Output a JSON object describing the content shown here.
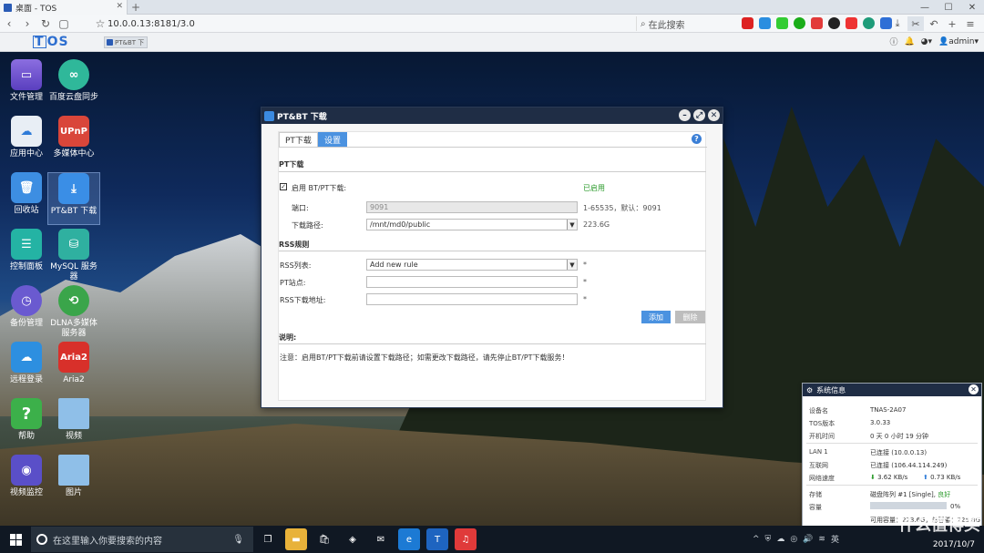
{
  "browser": {
    "tab_title": "桌面 - TOS",
    "new_tab": "+",
    "url": "10.0.0.13:8181/3.0",
    "search_placeholder": "在此搜索"
  },
  "tos_bar": {
    "logo": "OS",
    "logo_t": "T",
    "task_tab_label": "PT&BT 下",
    "user": "admin"
  },
  "desktop_icons": [
    {
      "label": "文件管理"
    },
    {
      "label": "百度云盘同步"
    },
    {
      "label": "应用中心"
    },
    {
      "label": "多媒体中心",
      "icon_text": "UPnP"
    },
    {
      "label": "回收站"
    },
    {
      "label": "PT&BT 下载"
    },
    {
      "label": "控制面板"
    },
    {
      "label": "MySQL 服务器"
    },
    {
      "label": "备份管理"
    },
    {
      "label": "DLNA多媒体服务器"
    },
    {
      "label": "远程登录"
    },
    {
      "label": "Aria2",
      "icon_text": "Aria2"
    },
    {
      "label": "帮助",
      "icon_text": "?"
    },
    {
      "label": "视频"
    },
    {
      "label": "视频监控"
    },
    {
      "label": "图片"
    }
  ],
  "pt_window": {
    "title": "PT&BT 下载",
    "tab_download": "PT下载",
    "tab_settings": "设置",
    "section_pt": "PT下载",
    "enable_label": "启用 BT/PT下载:",
    "enabled_status": "已启用",
    "port_label": "端口:",
    "port_value": "9091",
    "port_hint": "1-65535，默认：9091",
    "path_label": "下载路径:",
    "path_value": "/mnt/md0/public",
    "path_size": "223.6G",
    "section_rss": "RSS规则",
    "rss_list_label": "RSS列表:",
    "rss_list_value": "Add new rule",
    "pt_site_label": "PT站点:",
    "rss_url_label": "RSS下载地址:",
    "required_mark": "*",
    "add_button": "添加",
    "delete_button": "删除",
    "section_notes": "说明:",
    "note_text": "注意：启用BT/PT下载前请设置下载路径；如需更改下载路径，请先停止BT/PT下载服务！"
  },
  "sysinfo": {
    "title": "系统信息",
    "device_label": "设备名",
    "device_value": "TNAS-2A07",
    "tos_label": "TOS版本",
    "tos_value": "3.0.33",
    "uptime_label": "开机时间",
    "uptime_value": "0 天 0 小时 19 分钟",
    "lan_label": "LAN 1",
    "lan_value": "已连接 (10.0.0.13)",
    "internet_label": "互联网",
    "internet_value": "已连接 (106.44.114.249)",
    "speed_label": "网络速度",
    "download_speed": "3.62 KB/s",
    "upload_speed": "0.73 KB/s",
    "storage_label": "存储",
    "storage_value": "磁盘阵列 #1 [Single],",
    "storage_status": "良好",
    "capacity_label": "容量",
    "capacity_percent": "0%",
    "capacity_fraction": 0.0,
    "available": "可用容量：223.6G，总容量：225.8G"
  },
  "taskbar": {
    "search_placeholder": "在这里输入你要搜索的内容",
    "ime": "英",
    "date": "2017/10/7"
  },
  "watermark": "什么值得买",
  "colors": {
    "accent": "#4b92e0",
    "title_bar": "#1f2d45",
    "enabled_green": "#2a9a2a"
  }
}
